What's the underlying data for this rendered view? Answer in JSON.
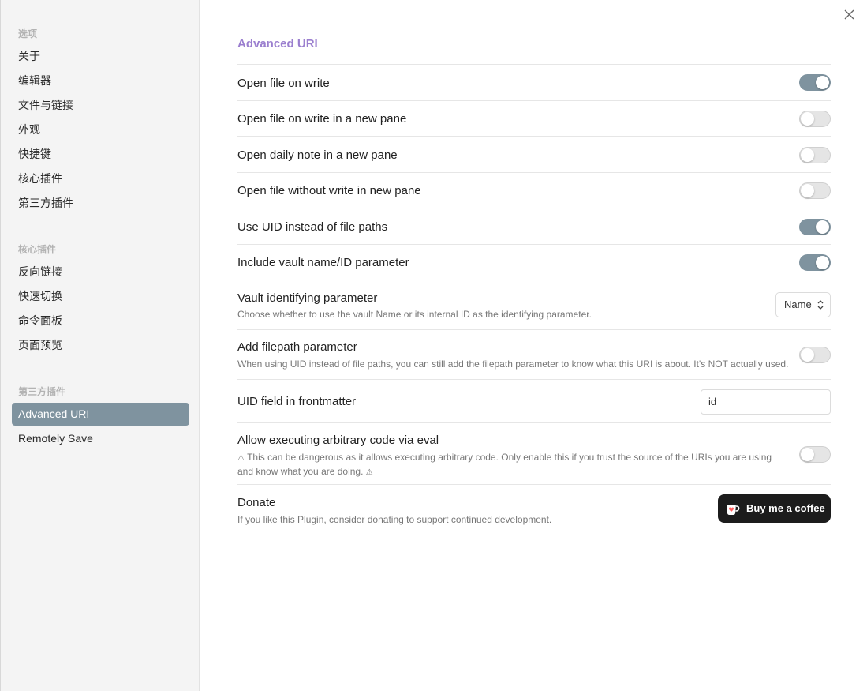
{
  "sidebar": {
    "groups": [
      {
        "title": "选项",
        "items": [
          "关于",
          "编辑器",
          "文件与链接",
          "外观",
          "快捷键",
          "核心插件",
          "第三方插件"
        ]
      },
      {
        "title": "核心插件",
        "items": [
          "反向链接",
          "快速切换",
          "命令面板",
          "页面预览"
        ]
      },
      {
        "title": "第三方插件",
        "items": [
          "Advanced URI",
          "Remotely Save"
        ]
      }
    ],
    "active_item": "Advanced URI"
  },
  "close_icon": "close-icon",
  "section_title": "Advanced URI",
  "settings": {
    "open_file_on_write": {
      "name": "Open file on write",
      "enabled": true
    },
    "open_file_on_write_new_pane": {
      "name": "Open file on write in a new pane",
      "enabled": false
    },
    "open_daily_note_new_pane": {
      "name": "Open daily note in a new pane",
      "enabled": false
    },
    "open_file_without_write": {
      "name": "Open file without write in new pane",
      "enabled": false
    },
    "use_uid": {
      "name": "Use UID instead of file paths",
      "enabled": true
    },
    "include_vault_name": {
      "name": "Include vault name/ID parameter",
      "enabled": true
    },
    "vault_identifying": {
      "name": "Vault identifying parameter",
      "desc": "Choose whether to use the vault Name or its internal ID as the identifying parameter.",
      "value": "Name"
    },
    "add_filepath": {
      "name": "Add filepath parameter",
      "desc": "When using UID instead of file paths, you can still add the filepath parameter to know what this URI is about. It's NOT actually used.",
      "enabled": false
    },
    "uid_field": {
      "name": "UID field in frontmatter",
      "value": "id"
    },
    "eval_code": {
      "name": "Allow executing arbitrary code via eval",
      "desc_line1": "This can be dangerous as it allows executing arbitrary code. Only enable this if you trust the source of the URIs you are using",
      "desc_line2": "and know what you are doing.",
      "enabled": false
    },
    "donate": {
      "name": "Donate",
      "desc": "If you like this Plugin, consider donating to support continued development.",
      "button_label": "Buy me a coffee"
    }
  },
  "colors": {
    "accent_purple": "#9b7fcf",
    "toggle_on": "#7f939f",
    "active_nav": "#7f939f"
  }
}
